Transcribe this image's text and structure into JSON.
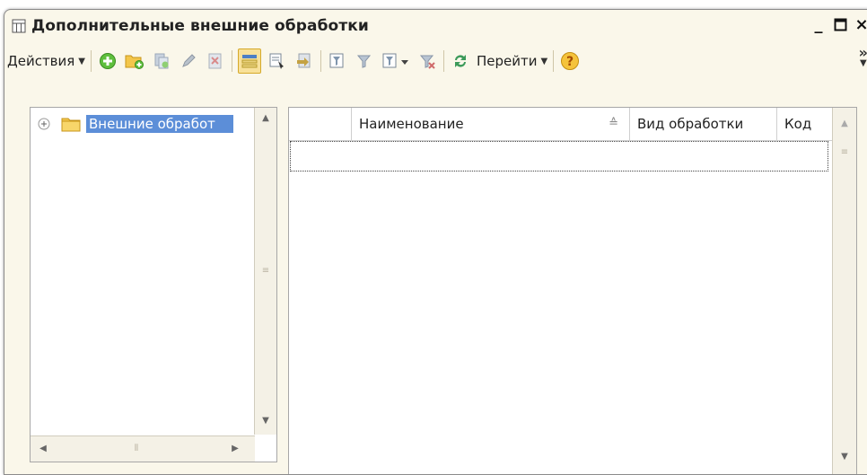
{
  "window": {
    "title": "Дополнительные внешние обработки",
    "controls": {
      "minimize": "_",
      "maximize": "□",
      "close": "×"
    }
  },
  "toolbar": {
    "actions_label": "Действия",
    "goto_label": "Перейти",
    "buttons": [
      "add-icon",
      "add-group-icon",
      "copy-icon",
      "edit-icon",
      "delete-icon",
      "tree-view-icon",
      "select-icon",
      "move-icon",
      "filter-icon",
      "filter-by-value-icon",
      "filter-dropdown-icon",
      "clear-filter-icon",
      "refresh-icon",
      "help-icon"
    ],
    "more_label": "»"
  },
  "tree": {
    "root_label": "Внешние обработ"
  },
  "table": {
    "columns": [
      "Наименование",
      "Вид обработки",
      "Код"
    ],
    "sort_indicator": "≙"
  },
  "colors": {
    "window_bg": "#faf7ea",
    "selection": "#5c8ed8",
    "active_button": "#f8e19a"
  }
}
